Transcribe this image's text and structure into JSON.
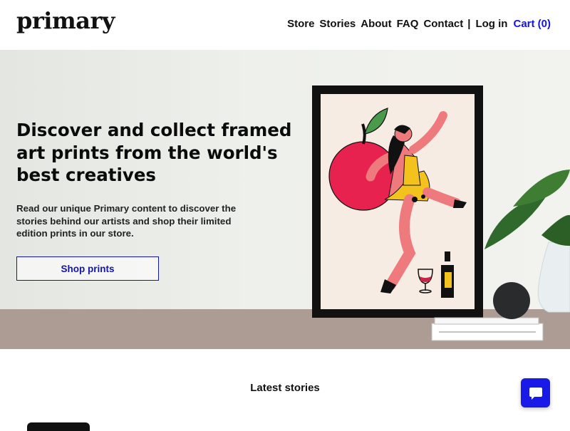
{
  "header": {
    "logo": "primary",
    "nav": {
      "store": "Store",
      "stories": "Stories",
      "about": "About",
      "faq": "FAQ",
      "contact": "Contact",
      "separator": "|",
      "login": "Log in",
      "cart": "Cart (0)"
    }
  },
  "hero": {
    "title": "Discover and collect framed art prints from the world's best creatives",
    "description": "Read our unique Primary content to discover the stories behind our artists and shop their limited edition prints in our store.",
    "cta_label": "Shop prints"
  },
  "latest_stories": {
    "title": "Latest stories"
  },
  "chat": {
    "icon": "chat-bubble-icon"
  },
  "colors": {
    "accent": "#1414e6",
    "button_border": "#1414a8",
    "shelf": "#ad9c93",
    "apple": "#e8224e",
    "figure_skin": "#ee7a7e",
    "dress": "#f3c21c"
  }
}
